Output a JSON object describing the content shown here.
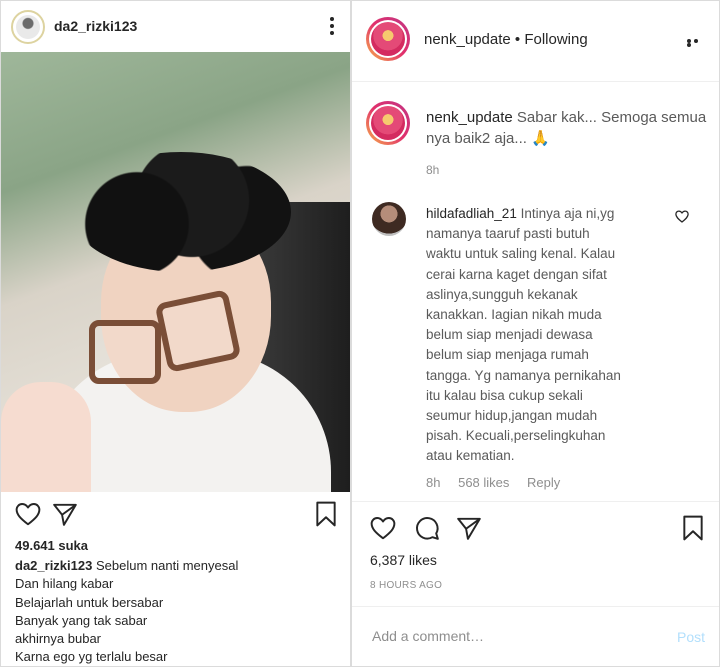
{
  "left_post": {
    "username": "da2_rizki123",
    "likes": "49.641 suka",
    "caption_user": "da2_rizki123",
    "caption_lines": [
      "Sebelum nanti menyesal",
      "Dan hilang kabar",
      "Belajarlah untuk bersabar",
      "Banyak yang tak sabar",
      "akhirnya bubar",
      "Karna ego yg terlalu besar"
    ]
  },
  "right_post": {
    "username": "nenk_update",
    "follow_status": "• Following",
    "caption_comment": {
      "username": "nenk_update",
      "text": "Sabar kak... Semoga semua nya baik2 aja... 🙏",
      "time": "8h"
    },
    "comment": {
      "username": "hildafadliah_21",
      "lines": [
        "Intinya aja ni,yg",
        "namanya taaruf pasti butuh",
        "waktu untuk saling kenal. Kalau",
        "cerai karna kaget dengan sifat",
        "aslinya,sungguh kekanak",
        "kanakkan. Iagian nikah muda",
        "belum siap menjadi dewasa",
        "belum siap menjaga rumah",
        "tangga. Yg namanya pernikahan",
        "itu kalau bisa cukup sekali",
        "seumur hidup,jangan mudah",
        "pisah. Kecuali,perselingkuhan",
        "atau kematian."
      ],
      "time": "8h",
      "likes": "568 likes",
      "reply": "Reply"
    },
    "likes": "6,387 likes",
    "time_ago": "8 HOURS AGO",
    "add_comment_placeholder": "Add a comment…",
    "post_label": "Post"
  },
  "icons": {
    "heart": "heart-icon",
    "comment": "comment-icon",
    "send": "send-icon",
    "bookmark": "bookmark-icon",
    "more": "more-icon"
  }
}
